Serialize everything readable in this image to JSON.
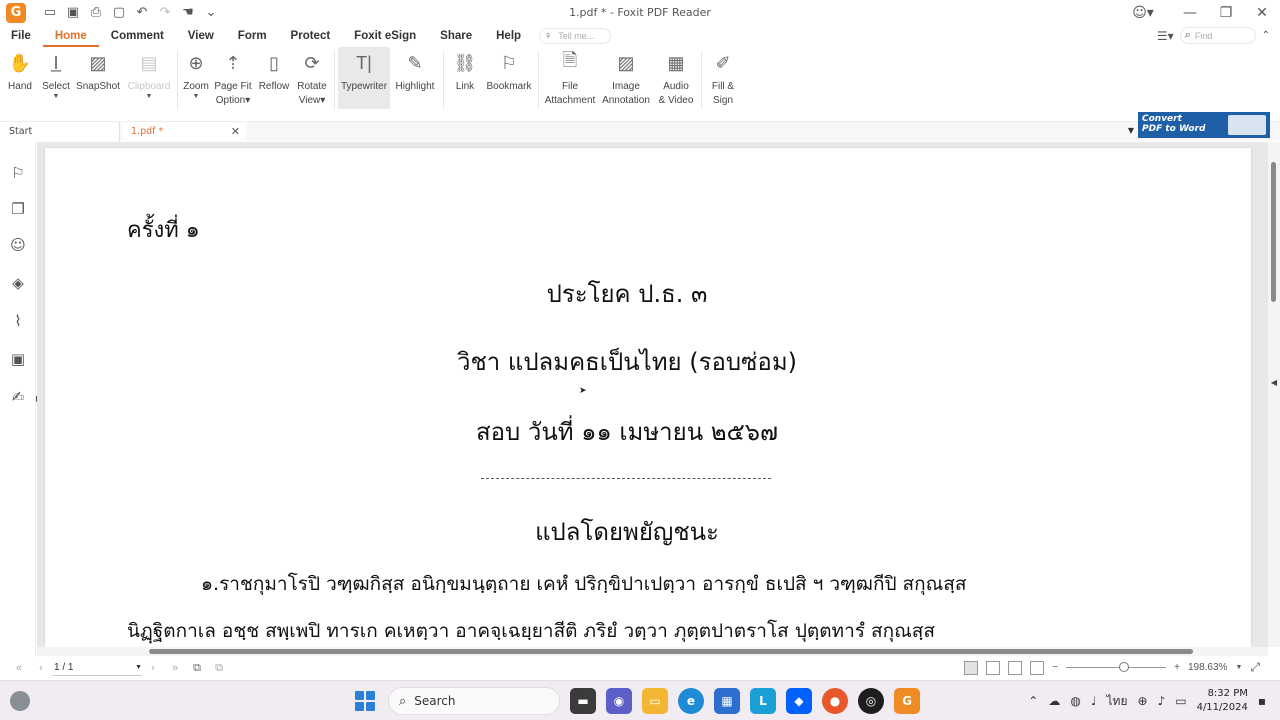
{
  "window": {
    "title": "1.pdf * - Foxit PDF Reader",
    "app_logo": "G"
  },
  "quick_access": [
    "folder-icon",
    "save-icon",
    "print-icon",
    "new-icon",
    "undo-icon",
    "redo-icon",
    "hand-dropdown-icon",
    "customize-icon"
  ],
  "menu": {
    "tabs": [
      "File",
      "Home",
      "Comment",
      "View",
      "Form",
      "Protect",
      "Foxit eSign",
      "Share",
      "Help"
    ],
    "active": "Home",
    "tell_me_placeholder": "Tell me...",
    "find_placeholder": "Find"
  },
  "ribbon": {
    "hand": "Hand",
    "select": "Select",
    "snapshot": "SnapShot",
    "clipboard": "Clipboard",
    "zoom": "Zoom",
    "page_fit_1": "Page Fit",
    "page_fit_2": "Option",
    "reflow": "Reflow",
    "rotate_1": "Rotate",
    "rotate_2": "View",
    "typewriter": "Typewriter",
    "highlight": "Highlight",
    "link": "Link",
    "bookmark": "Bookmark",
    "file_attach_1": "File",
    "file_attach_2": "Attachment",
    "image_annot_1": "Image",
    "image_annot_2": "Annotation",
    "audio_video_1": "Audio",
    "audio_video_2": "& Video",
    "fill_sign_1": "Fill &",
    "fill_sign_2": "Sign"
  },
  "tabs": {
    "start": "Start",
    "file": "1.pdf *"
  },
  "convert_banner": {
    "line1": "Convert",
    "line2": "PDF to Word"
  },
  "document": {
    "session": "ครั้งที่ ๑",
    "level": "ประโยค  ป.ธ. ๓",
    "subject": "วิชา  แปลมคธเป็นไทย (รอบซ่อม)",
    "date": "สอบ  วันที่   ๑๑   เมษายน    ๒๕๖๗",
    "translator": "แปลโดยพยัญชนะ",
    "line1": "๑.ราชกุมาโรปิ วฑฺฒกิสฺส อนิกฺขมนฺตฺถาย เคหํ ปริกฺขิปาเปตฺวา อารกฺขํ ธเปสิ ฯ วฑฺฒกีปิ สกุณสฺส",
    "line2": "นิฏฺฐิตกาเล  อชฺช สพฺเพปิ ทารเก คเหตฺวา อาคจฺเฉยฺยาสีติ ภริยํ วตฺวา ภุตฺตปาตราโส ปุตฺตทารํ สกุณสฺส"
  },
  "status": {
    "page": "1 / 1",
    "zoom": "198.63%",
    "zoom_fraction": 0.58
  },
  "taskbar": {
    "search": "Search",
    "lang": "ไทย",
    "time": "8:32 PM",
    "date": "4/11/2024"
  }
}
